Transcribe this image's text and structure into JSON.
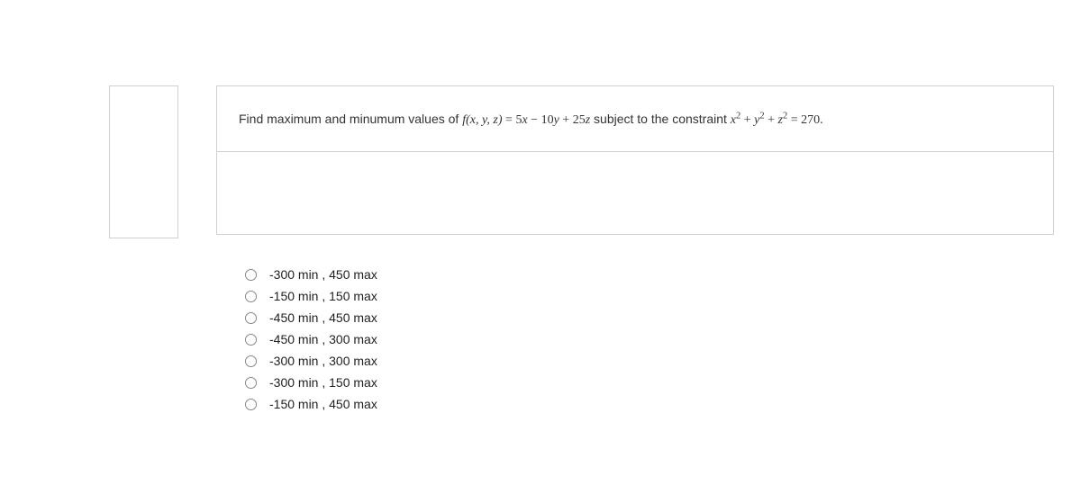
{
  "question": {
    "prefix": "Find maximum and minumum values of ",
    "func_head": "f",
    "func_args": "(x, y, z)",
    "equals": " = ",
    "expr_5x": "5x",
    "minus": " − ",
    "expr_10y": "10y",
    "plus1": " + ",
    "expr_25z": "25z",
    "subject": " subject to the constraint ",
    "x2": "x",
    "sup2a": "2",
    "plus2": " + ",
    "y2": "y",
    "sup2b": "2",
    "plus3": " + ",
    "z2": "z",
    "sup2c": "2",
    "eq270": " = 270."
  },
  "options": [
    {
      "label": "-300 min , 450 max"
    },
    {
      "label": "-150 min , 150 max"
    },
    {
      "label": "-450 min , 450 max"
    },
    {
      "label": "-450 min , 300 max"
    },
    {
      "label": "-300 min , 300 max"
    },
    {
      "label": "-300 min , 150 max"
    },
    {
      "label": "-150 min , 450 max"
    }
  ]
}
